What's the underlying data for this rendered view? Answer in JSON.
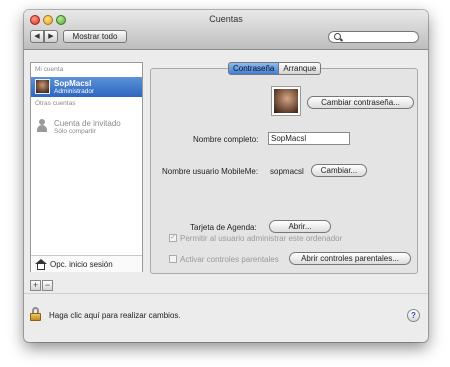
{
  "window": {
    "title": "Cuentas"
  },
  "toolbar": {
    "back_icon": "◀",
    "forward_icon": "▶",
    "show_all_label": "Mostrar todo",
    "search_placeholder": ""
  },
  "sidebar": {
    "my_account_header": "Mi cuenta",
    "selected_user": {
      "name": "SopMacsl",
      "role": "Administrador"
    },
    "other_accounts_header": "Otras cuentas",
    "guest": {
      "name": "Cuenta de invitado",
      "subtitle": "Sólo compartir"
    },
    "login_options_label": "Opc. inicio sesión",
    "add_label": "+",
    "remove_label": "−"
  },
  "tabs": {
    "active": "Contraseña",
    "inactive": "Arranque"
  },
  "password_tab": {
    "change_password_button": "Cambiar contraseña...",
    "full_name_label": "Nombre completo:",
    "full_name_value": "SopMacsl",
    "mobileme_label": "Nombre usuario MobileMe:",
    "mobileme_value": "sopmacsl",
    "change_button": "Cambiar...",
    "address_card_label": "Tarjeta de Agenda:",
    "open_button": "Abrir...",
    "allow_admin_label": "Permitir al usuario administrar este ordenador",
    "allow_admin_checked": true,
    "parental_controls_label": "Activar controles parentales",
    "parental_controls_checked": false,
    "open_parental_button": "Abrir controles parentales..."
  },
  "footer": {
    "lock_text": "Haga clic aquí para realizar cambios.",
    "help_label": "?"
  },
  "colors": {
    "selection": "#2d66bf",
    "active_tab": "#3f7fd6"
  }
}
